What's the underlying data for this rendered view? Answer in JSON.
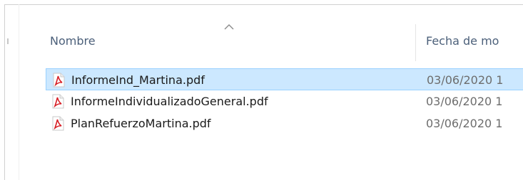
{
  "columns": {
    "name_label": "Nombre",
    "date_label": "Fecha de mo"
  },
  "files": [
    {
      "name": "InformeInd_Martina.pdf",
      "date": "03/06/2020 1",
      "selected": true,
      "icon": "pdf-file-icon"
    },
    {
      "name": "InformeIndividualizadoGeneral.pdf",
      "date": "03/06/2020 1",
      "selected": false,
      "icon": "pdf-file-icon"
    },
    {
      "name": "PlanRefuerzoMartina.pdf",
      "date": "03/06/2020 1",
      "selected": false,
      "icon": "pdf-file-icon"
    }
  ],
  "colors": {
    "selection_bg": "#cce8ff",
    "selection_border": "#99d1ff",
    "header_text": "#4c607a",
    "pdf_red": "#d71f26"
  }
}
